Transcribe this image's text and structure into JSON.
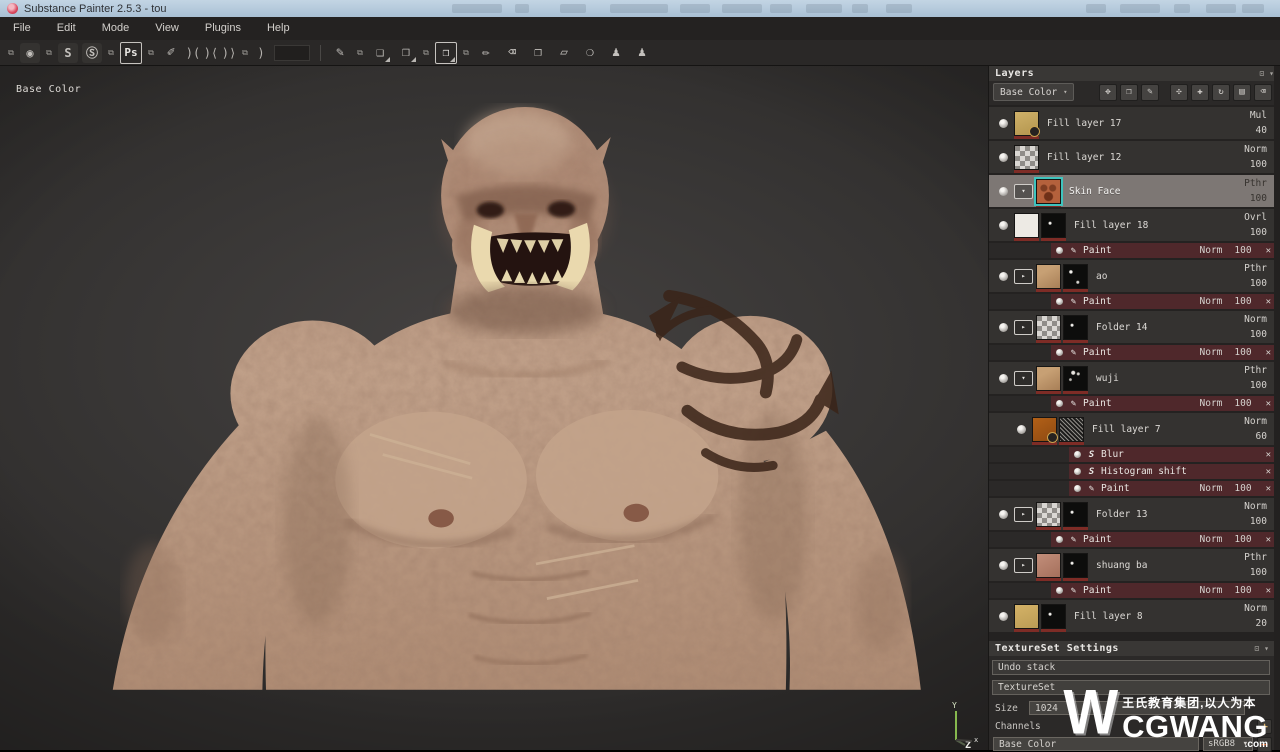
{
  "window": {
    "title": "Substance Painter 2.5.3 - tou"
  },
  "menu": {
    "items": [
      "File",
      "Edit",
      "Mode",
      "View",
      "Plugins",
      "Help"
    ]
  },
  "icons": {
    "close": "✕",
    "dropdown": "▾",
    "float": "⊡",
    "collapse": "▾",
    "plus": "+",
    "minus": "−",
    "folder": "▸",
    "smart": "▾",
    "paint_fx": "✎",
    "substance_fx": "S"
  },
  "toolbar": {
    "items": [
      {
        "s": "link",
        "n": "export-link-icon",
        "g": "⧉"
      },
      {
        "s": "app",
        "n": "iray-renderer-icon",
        "g": "◉"
      },
      {
        "s": "link",
        "n": "share-link-icon",
        "g": "⧉"
      },
      {
        "s": "app",
        "n": "substance-share-icon",
        "g": "S"
      },
      {
        "s": "app",
        "n": "substance-source-icon",
        "g": "Ⓢ"
      },
      {
        "s": "link",
        "n": "photoshop-link-icon",
        "g": "⧉"
      },
      {
        "s": "appbox",
        "n": "photoshop-export-icon",
        "g": "Ps"
      },
      {
        "s": "link",
        "n": "pen-link-icon",
        "g": "⧉"
      },
      {
        "s": "tool",
        "n": "lazy-mouse-pen-icon",
        "g": "✐"
      },
      {
        "s": "paren",
        "n": "symmetry-icon-1",
        "g": ")("
      },
      {
        "s": "paren",
        "n": "symmetry-icon-2",
        "g": ")⟨"
      },
      {
        "s": "paren",
        "n": "symmetry-icon-3",
        "g": ")⟩"
      },
      {
        "s": "link",
        "n": "bracket-link-icon",
        "g": "⧉"
      },
      {
        "s": "paren",
        "n": "stencil-icon",
        "g": ")"
      },
      {
        "s": "field",
        "n": "value-field",
        "g": ""
      },
      {
        "s": "divider",
        "n": "toolbar-divider",
        "g": ""
      },
      {
        "s": "tool",
        "n": "quick-brush-icon",
        "g": "✎"
      },
      {
        "s": "link",
        "n": "camera-link-icon",
        "g": "⧉"
      },
      {
        "s": "tool tri",
        "n": "perspective-camera-icon",
        "g": "❑"
      },
      {
        "s": "tool tri",
        "n": "orthographic-view-icon",
        "g": "❒"
      },
      {
        "s": "link",
        "n": "view-link-icon",
        "g": "⧉"
      },
      {
        "s": "appbox tri",
        "n": "rotate-view-icon",
        "g": "❒"
      },
      {
        "s": "link",
        "n": "tools-link-icon",
        "g": "⧉"
      },
      {
        "s": "tool",
        "n": "paint-tool-icon",
        "g": "✏"
      },
      {
        "s": "tool",
        "n": "eraser-tool-icon",
        "g": "⌫"
      },
      {
        "s": "tool",
        "n": "projection-tool-icon",
        "g": "❐"
      },
      {
        "s": "tool",
        "n": "polygon-fill-tool-icon",
        "g": "▱"
      },
      {
        "s": "tool",
        "n": "smudge-tool-icon",
        "g": "❍"
      },
      {
        "s": "tool",
        "n": "clone-tool-icon",
        "g": "♟"
      },
      {
        "s": "tool",
        "n": "material-picker-tool-icon",
        "g": "♟"
      }
    ]
  },
  "viewport": {
    "channel_label": "Base Color",
    "gizmo": {
      "y": "Y",
      "z": "Z",
      "x": "x"
    }
  },
  "layers": {
    "title": "Layers",
    "channel": "Base Color",
    "tools": [
      {
        "n": "layer-blend-icon",
        "g": "✥"
      },
      {
        "n": "add-fill-layer-icon",
        "g": "❒"
      },
      {
        "n": "add-paint-layer-icon",
        "g": "✎"
      },
      {
        "n": "add-smart-material-icon",
        "g": "✣"
      },
      {
        "n": "add-generator-icon",
        "g": "✚"
      },
      {
        "n": "add-effect-icon",
        "g": "↻"
      },
      {
        "n": "add-folder-icon",
        "g": "▤"
      },
      {
        "n": "delete-layer-icon",
        "g": "⌫"
      }
    ],
    "rows": [
      {
        "kind": "layer",
        "name": "Fill layer 17",
        "blend": "Mul",
        "opacity": "40",
        "thumb": "gold",
        "badged": true
      },
      {
        "kind": "layer",
        "name": "Fill layer 12",
        "blend": "Norm",
        "opacity": "100",
        "thumb": "checker"
      },
      {
        "kind": "layer",
        "name": "Skin Face",
        "blend": "Pthr",
        "opacity": "100",
        "thumb": "face",
        "icon": "smart",
        "selected": true
      },
      {
        "kind": "layer",
        "name": "Fill layer 18",
        "blend": "Ovrl",
        "opacity": "100",
        "thumb": "white",
        "mask": "mask1"
      },
      {
        "kind": "fx",
        "name": "Paint",
        "blend": "Norm",
        "opacity": "100",
        "icon": "paint"
      },
      {
        "kind": "layer",
        "name": "ao",
        "blend": "Pthr",
        "opacity": "100",
        "thumb": "tan",
        "mask": "mask2",
        "icon": "folder"
      },
      {
        "kind": "fx",
        "name": "Paint",
        "blend": "Norm",
        "opacity": "100",
        "icon": "paint"
      },
      {
        "kind": "layer",
        "name": "Folder 14",
        "blend": "Norm",
        "opacity": "100",
        "thumb": "checker",
        "mask": "mask1",
        "icon": "folder"
      },
      {
        "kind": "fx",
        "name": "Paint",
        "blend": "Norm",
        "opacity": "100",
        "icon": "paint"
      },
      {
        "kind": "layer",
        "name": "wuji",
        "blend": "Pthr",
        "opacity": "100",
        "thumb": "tan",
        "mask": "dots",
        "icon": "smart"
      },
      {
        "kind": "fx",
        "name": "Paint",
        "blend": "Norm",
        "opacity": "100",
        "icon": "paint"
      },
      {
        "kind": "layer",
        "name": "Fill layer 7",
        "blend": "Norm",
        "opacity": "60",
        "thumb": "orange",
        "mask": "noise",
        "indent": 1,
        "badged": true
      },
      {
        "kind": "fx",
        "name": "Blur",
        "icon": "substance",
        "indent": 1
      },
      {
        "kind": "fx",
        "name": "Histogram shift",
        "icon": "substance",
        "indent": 1
      },
      {
        "kind": "fx",
        "name": "Paint",
        "blend": "Norm",
        "opacity": "100",
        "icon": "paint",
        "indent": 1
      },
      {
        "kind": "layer",
        "name": "Folder 13",
        "blend": "Norm",
        "opacity": "100",
        "thumb": "checker",
        "mask": "mask1",
        "icon": "folder"
      },
      {
        "kind": "fx",
        "name": "Paint",
        "blend": "Norm",
        "opacity": "100",
        "icon": "paint"
      },
      {
        "kind": "layer",
        "name": "shuang ba",
        "blend": "Pthr",
        "opacity": "100",
        "thumb": "pink",
        "mask": "mask1",
        "icon": "folder"
      },
      {
        "kind": "fx",
        "name": "Paint",
        "blend": "Norm",
        "opacity": "100",
        "icon": "paint"
      },
      {
        "kind": "layer",
        "name": "Fill layer 8",
        "blend": "Norm",
        "opacity": "20",
        "thumb": "gold2",
        "mask": "mask1"
      }
    ]
  },
  "textureset": {
    "title": "TextureSet Settings",
    "undo_button": "Undo stack",
    "section": "TextureSet",
    "size_label": "Size",
    "size_value": "1024",
    "channels_label": "Channels",
    "channel_name": "Base Color",
    "channel_format": "sRGB8"
  },
  "watermark": {
    "logo_letter": "W",
    "cn_line": "王氏教育集团,以人为本",
    "brand": "CGWANG",
    "domain": ".com"
  }
}
